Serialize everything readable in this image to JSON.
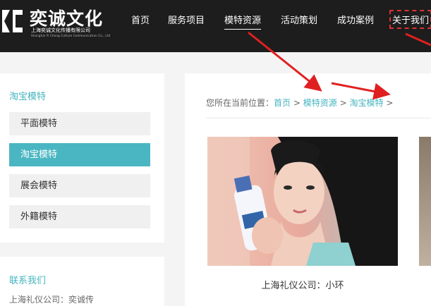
{
  "header": {
    "logo_title": "奕诚文化",
    "logo_sub_cn": "上海奕诚文化传播有限公司",
    "logo_sub_en": "Shanghai Yi Cheng Culture Communication Co., Ltd"
  },
  "nav": {
    "items": [
      {
        "label": "首页"
      },
      {
        "label": "服务项目"
      },
      {
        "label": "模特资源"
      },
      {
        "label": "活动策划"
      },
      {
        "label": "成功案例"
      },
      {
        "label": "关于我们"
      }
    ],
    "active_index": 2
  },
  "sidebar": {
    "title": "淘宝模特",
    "items": [
      {
        "label": "平面模特"
      },
      {
        "label": "淘宝模特"
      },
      {
        "label": "展会模特"
      },
      {
        "label": "外籍模特"
      }
    ],
    "active_index": 1
  },
  "sidebar_contact": {
    "title": "联系我们",
    "text": "上海礼仪公司：奕诚传"
  },
  "breadcrumb": {
    "prefix": "您所在当前位置：",
    "items": [
      "首页",
      "模特资源",
      "淘宝模特"
    ],
    "separator": ">"
  },
  "gallery": {
    "items": [
      {
        "caption": "上海礼仪公司：小环"
      }
    ]
  },
  "colors": {
    "accent": "#4ab6c2",
    "header_bg": "#1d1d1d",
    "annotation_red": "#e02020"
  }
}
